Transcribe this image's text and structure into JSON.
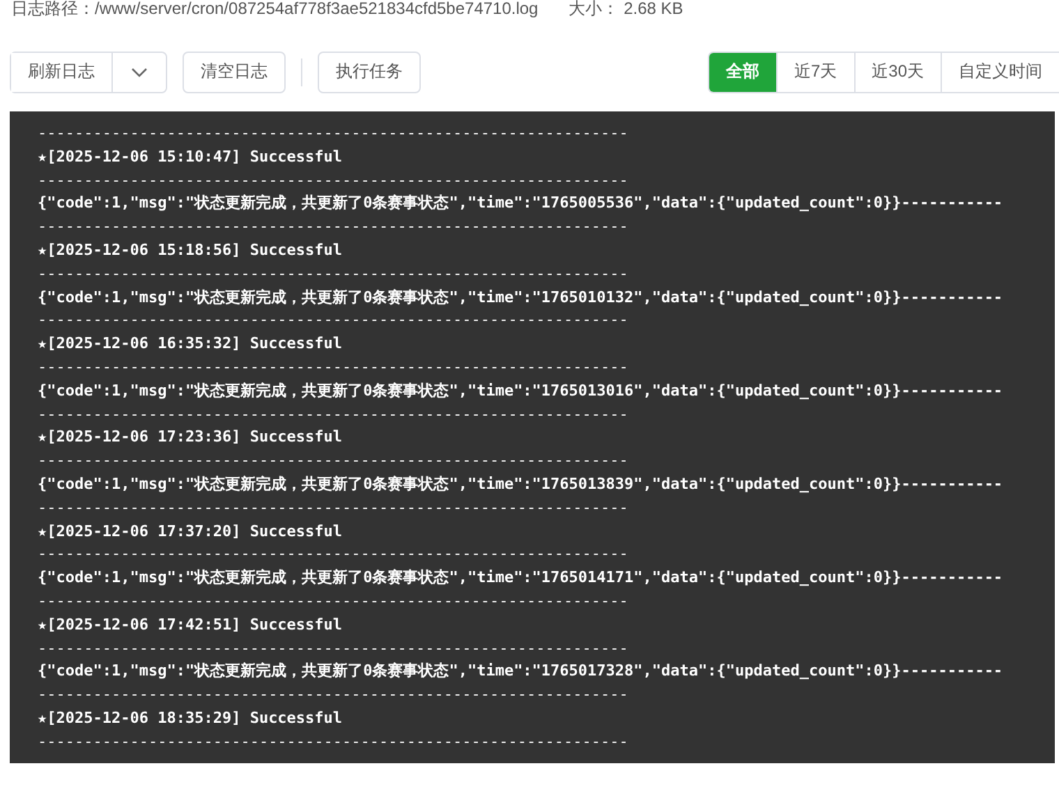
{
  "info": {
    "path_label": "日志路径：/www/server/cron/087254af778f3ae521834cfd5be74710.log",
    "size_label": "大小：  2.68 KB"
  },
  "toolbar": {
    "buttons": [
      {
        "label": "刷新日志",
        "kind": "split"
      },
      {
        "label": "清空日志",
        "kind": "plain"
      },
      {
        "label": "执行任务",
        "kind": "plain"
      }
    ]
  },
  "range_tabs": [
    {
      "label": "全部",
      "selected": true
    },
    {
      "label": "近7天",
      "selected": false
    },
    {
      "label": "近30天",
      "selected": false
    },
    {
      "label": "自定义时间",
      "selected": false
    }
  ],
  "log_lines": [
    {
      "kind": "rule",
      "text": "----------------------------------------------------------------"
    },
    {
      "kind": "header",
      "text": "★[2025-12-06 15:10:47] Successful"
    },
    {
      "kind": "rule",
      "text": "----------------------------------------------------------------"
    },
    {
      "kind": "body",
      "text": "{\"code\":1,\"msg\":\"状态更新完成，共更新了0条赛事状态\",\"time\":\"1765005536\",\"data\":{\"updated_count\":0}}-----------"
    },
    {
      "kind": "rule",
      "text": "----------------------------------------------------------------"
    },
    {
      "kind": "header",
      "text": "★[2025-12-06 15:18:56] Successful"
    },
    {
      "kind": "rule",
      "text": "----------------------------------------------------------------"
    },
    {
      "kind": "body",
      "text": "{\"code\":1,\"msg\":\"状态更新完成，共更新了0条赛事状态\",\"time\":\"1765010132\",\"data\":{\"updated_count\":0}}-----------"
    },
    {
      "kind": "rule",
      "text": "----------------------------------------------------------------"
    },
    {
      "kind": "header",
      "text": "★[2025-12-06 16:35:32] Successful"
    },
    {
      "kind": "rule",
      "text": "----------------------------------------------------------------"
    },
    {
      "kind": "body",
      "text": "{\"code\":1,\"msg\":\"状态更新完成，共更新了0条赛事状态\",\"time\":\"1765013016\",\"data\":{\"updated_count\":0}}-----------"
    },
    {
      "kind": "rule",
      "text": "----------------------------------------------------------------"
    },
    {
      "kind": "header",
      "text": "★[2025-12-06 17:23:36] Successful"
    },
    {
      "kind": "rule",
      "text": "----------------------------------------------------------------"
    },
    {
      "kind": "body",
      "text": "{\"code\":1,\"msg\":\"状态更新完成，共更新了0条赛事状态\",\"time\":\"1765013839\",\"data\":{\"updated_count\":0}}-----------"
    },
    {
      "kind": "rule",
      "text": "----------------------------------------------------------------"
    },
    {
      "kind": "header",
      "text": "★[2025-12-06 17:37:20] Successful"
    },
    {
      "kind": "rule",
      "text": "----------------------------------------------------------------"
    },
    {
      "kind": "body",
      "text": "{\"code\":1,\"msg\":\"状态更新完成，共更新了0条赛事状态\",\"time\":\"1765014171\",\"data\":{\"updated_count\":0}}-----------"
    },
    {
      "kind": "rule",
      "text": "----------------------------------------------------------------"
    },
    {
      "kind": "header",
      "text": "★[2025-12-06 17:42:51] Successful"
    },
    {
      "kind": "rule",
      "text": "----------------------------------------------------------------"
    },
    {
      "kind": "body",
      "text": "{\"code\":1,\"msg\":\"状态更新完成，共更新了0条赛事状态\",\"time\":\"1765017328\",\"data\":{\"updated_count\":0}}-----------"
    },
    {
      "kind": "rule",
      "text": "----------------------------------------------------------------"
    },
    {
      "kind": "header",
      "text": "★[2025-12-06 18:35:29] Successful"
    },
    {
      "kind": "rule",
      "text": "----------------------------------------------------------------"
    }
  ]
}
